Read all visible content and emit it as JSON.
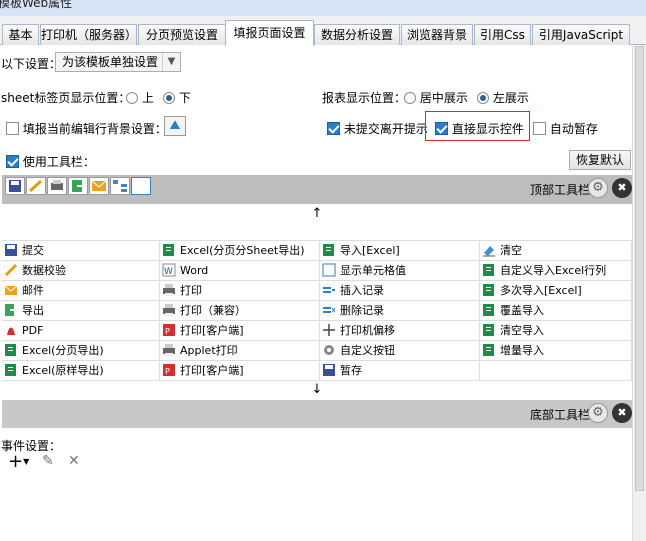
{
  "window_title": "模板Web属性",
  "tabs": [
    {
      "label": "基本"
    },
    {
      "label": "打印机（服务器）"
    },
    {
      "label": "分页预览设置"
    },
    {
      "label": "填报页面设置"
    },
    {
      "label": "数据分析设置"
    },
    {
      "label": "浏览器背景"
    },
    {
      "label": "引用Css"
    },
    {
      "label": "引用JavaScript"
    }
  ],
  "settings_scope": {
    "label": "以下设置：",
    "selected": "为该模板单独设置"
  },
  "sheet_tab_position": {
    "label": "sheet标签页显示位置：",
    "options": [
      {
        "label": "上",
        "checked": false
      },
      {
        "label": "下",
        "checked": true
      }
    ]
  },
  "report_position": {
    "label": "报表显示位置：",
    "options": [
      {
        "label": "居中展示",
        "checked": false
      },
      {
        "label": "左展示",
        "checked": true
      }
    ]
  },
  "row_background": {
    "label": "填报当前编辑行背景设置：",
    "checked": false
  },
  "unsubmitted_prompt": {
    "label": "未提交离开提示",
    "checked": true
  },
  "direct_controls": {
    "label": "直接显示控件",
    "checked": true
  },
  "auto_save": {
    "label": "自动暂存",
    "checked": false
  },
  "use_toolbar": {
    "label": "使用工具栏：",
    "checked": true
  },
  "restore_default": "恢复默认",
  "top_toolbar_label": "顶部工具栏",
  "bottom_toolbar_label": "底部工具栏",
  "up_arrow": "↑",
  "down_arrow": "↓",
  "toolbar_icons": [
    "save-icon",
    "verify-icon",
    "print-icon",
    "export-icon",
    "email-icon",
    "tree-icon",
    "blank-icon"
  ],
  "buttons": [
    [
      "提交",
      "Excel(分页分Sheet导出)",
      "导入[Excel]",
      "清空"
    ],
    [
      "数据校验",
      "Word",
      "显示单元格值",
      "自定义导入Excel行列"
    ],
    [
      "邮件",
      "打印",
      "插入记录",
      "多次导入[Excel]"
    ],
    [
      "导出",
      "打印（兼容）",
      "删除记录",
      "覆盖导入"
    ],
    [
      "PDF",
      "打印[客户端]",
      "打印机偏移",
      "清空导入"
    ],
    [
      "Excel(分页导出)",
      "Applet打印",
      "自定义按钮",
      "增量导入"
    ],
    [
      "Excel(原样导出)",
      "打印[客户端]",
      "暂存",
      ""
    ]
  ],
  "button_icons": [
    [
      "save-icon",
      "excel-icon",
      "excel-icon",
      "eraser-icon"
    ],
    [
      "verify-icon",
      "word-icon",
      "cell-icon",
      "excel-icon"
    ],
    [
      "email-icon",
      "print-icon",
      "insert-row-icon",
      "excel-icon"
    ],
    [
      "export-icon",
      "print-icon",
      "delete-row-icon",
      "excel-icon"
    ],
    [
      "pdf-icon",
      "pdf-print-icon",
      "move-icon",
      "excel-icon"
    ],
    [
      "excel-icon",
      "print-icon",
      "gear-icon",
      "excel-icon"
    ],
    [
      "excel-icon",
      "pdf-print-icon",
      "save-icon",
      ""
    ]
  ],
  "event_settings": {
    "label": "事件设置："
  },
  "colors": {
    "accent": "#2d7ec9",
    "highlight_border": "#e0242a",
    "toolbar_band": "#c8c8c8",
    "excel_green": "#1e8a4c",
    "pdf_red": "#d32f2f"
  }
}
